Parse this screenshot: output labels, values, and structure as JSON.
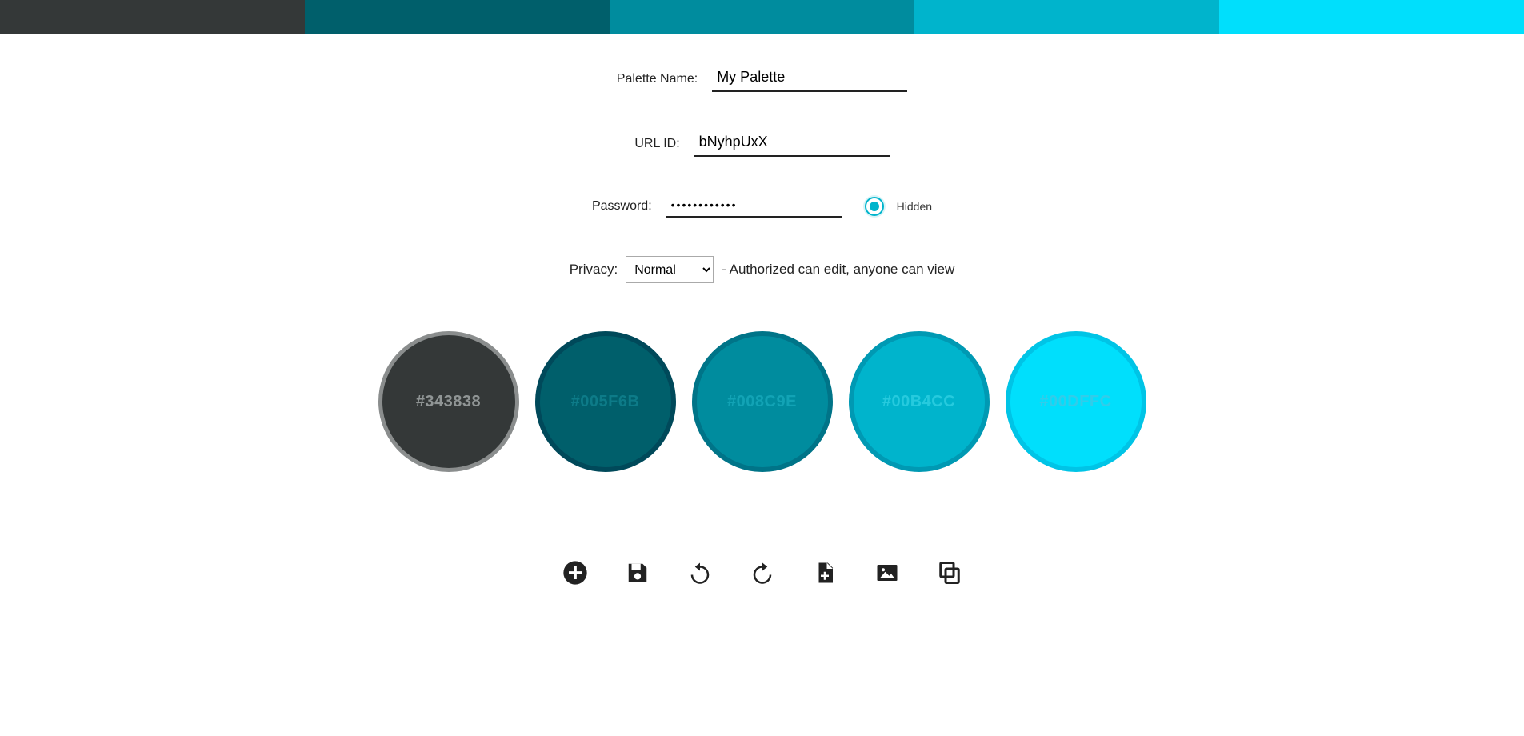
{
  "palette": {
    "strip_colors": [
      "#343838",
      "#005F6B",
      "#008C9E",
      "#00B4CC",
      "#00DFFC"
    ]
  },
  "form": {
    "name_label": "Palette Name:",
    "name_value": "My Palette",
    "url_label": "URL ID:",
    "url_value": "bNyhpUxX",
    "password_label": "Password:",
    "password_value": "••••••••••••",
    "hidden_label": "Hidden",
    "privacy_label": "Privacy:",
    "privacy_selected": "Normal",
    "privacy_options": [
      "Normal"
    ],
    "privacy_desc": "- Authorized can edit, anyone can view"
  },
  "swatches": [
    {
      "hex": "#343838",
      "label": "#343838",
      "text_color": "#9aa0a0",
      "selected": true,
      "border": "#8a8d8d"
    },
    {
      "hex": "#005F6B",
      "label": "#005F6B",
      "text_color": "#0f7f8c",
      "selected": false,
      "border": "#00495a"
    },
    {
      "hex": "#008C9E",
      "label": "#008C9E",
      "text_color": "#15a6b8",
      "selected": false,
      "border": "#007488"
    },
    {
      "hex": "#00B4CC",
      "label": "#00B4CC",
      "text_color": "#2bcde0",
      "selected": false,
      "border": "#0099b3"
    },
    {
      "hex": "#00DFFC",
      "label": "#00DFFC",
      "text_color": "#38cbe8",
      "selected": false,
      "border": "#00c4e6"
    }
  ],
  "toolbar": {
    "add": "add-icon",
    "save": "save-icon",
    "undo": "undo-icon",
    "redo": "redo-icon",
    "new_file": "new-file-icon",
    "image": "image-icon",
    "copy": "copy-icon"
  }
}
